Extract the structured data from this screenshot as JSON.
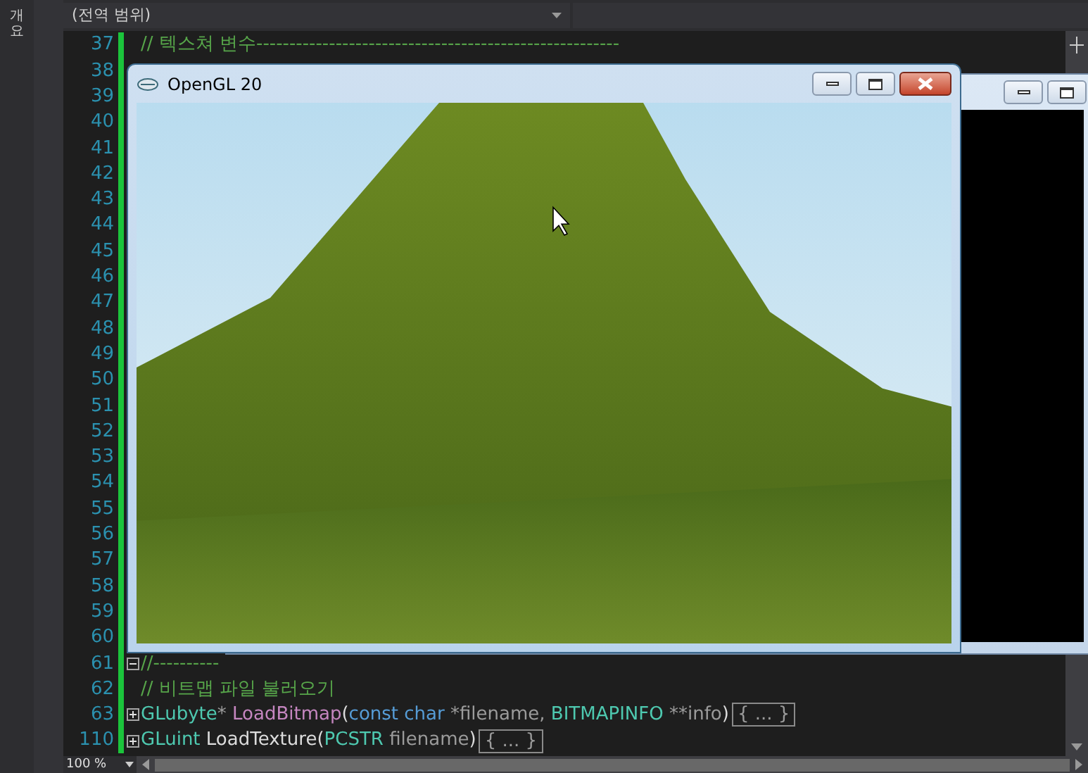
{
  "side_tab": {
    "label": "개요"
  },
  "navigation": {
    "scope": "(전역 범위)"
  },
  "editor": {
    "lines": [
      {
        "number": "37",
        "tokens": [
          {
            "kind": "comment",
            "text": "// 텍스쳐 변수-------------------------------------------------------"
          }
        ]
      },
      {
        "number": "38"
      },
      {
        "number": "39"
      },
      {
        "number": "40"
      },
      {
        "number": "41"
      },
      {
        "number": "42"
      },
      {
        "number": "43"
      },
      {
        "number": "44"
      },
      {
        "number": "45"
      },
      {
        "number": "46"
      },
      {
        "number": "47"
      },
      {
        "number": "48"
      },
      {
        "number": "49"
      },
      {
        "number": "50"
      },
      {
        "number": "51"
      },
      {
        "number": "52"
      },
      {
        "number": "53"
      },
      {
        "number": "54"
      },
      {
        "number": "55"
      },
      {
        "number": "56"
      },
      {
        "number": "57"
      },
      {
        "number": "58"
      },
      {
        "number": "59"
      },
      {
        "number": "60"
      },
      {
        "number": "61",
        "collapsed": false,
        "tokens": [
          {
            "kind": "comment",
            "text": "//----------"
          }
        ]
      },
      {
        "number": "62",
        "tokens": [
          {
            "kind": "comment",
            "text": "// 비트맵 파일 불러오기"
          }
        ]
      },
      {
        "number": "63",
        "collapsed": true,
        "tokens": [
          {
            "kind": "type",
            "text": "GLubyte"
          },
          {
            "kind": "param",
            "text": "* "
          },
          {
            "kind": "func",
            "text": "LoadBitmap"
          },
          {
            "kind": "plain",
            "text": "("
          },
          {
            "kind": "keyword",
            "text": "const char "
          },
          {
            "kind": "param",
            "text": "*filename, "
          },
          {
            "kind": "type",
            "text": "BITMAPINFO "
          },
          {
            "kind": "param",
            "text": "**info"
          },
          {
            "kind": "plain",
            "text": ")"
          },
          {
            "kind": "collapsed",
            "text": "{ ... }"
          }
        ]
      },
      {
        "number": "110",
        "collapsed": true,
        "tokens": [
          {
            "kind": "type",
            "text": "GLuint "
          },
          {
            "kind": "plain",
            "text": "LoadTexture("
          },
          {
            "kind": "type",
            "text": "PCSTR "
          },
          {
            "kind": "param",
            "text": "filename"
          },
          {
            "kind": "plain",
            "text": ")"
          },
          {
            "kind": "collapsed",
            "text": "{ ... }"
          }
        ]
      }
    ]
  },
  "opengl_window": {
    "title": "OpenGL 20"
  },
  "status_bar": {
    "zoom": "100 %"
  }
}
